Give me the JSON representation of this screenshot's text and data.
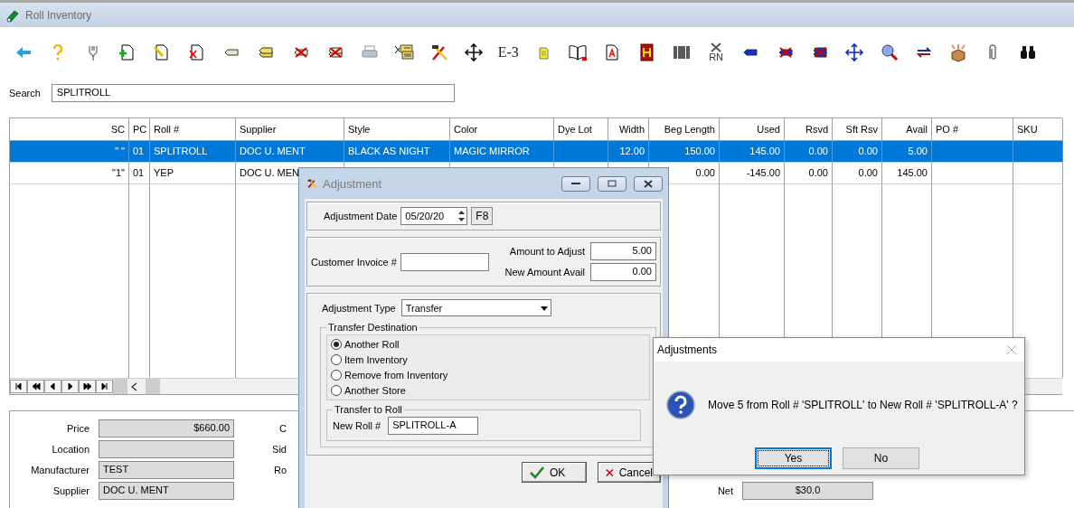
{
  "window": {
    "title": "Roll Inventory"
  },
  "toolbar": [
    {
      "kind": "icon"
    },
    {
      "kind": "icon"
    },
    {
      "kind": "icon"
    },
    {
      "kind": "icon"
    },
    {
      "kind": "icon"
    },
    {
      "kind": "icon"
    },
    {
      "kind": "icon"
    },
    {
      "kind": "icon"
    },
    {
      "kind": "icon"
    },
    {
      "kind": "icon"
    },
    {
      "kind": "icon"
    },
    {
      "kind": "icon"
    },
    {
      "kind": "icon"
    },
    {
      "kind": "icon"
    },
    {
      "kind": "text",
      "label": "E-3"
    },
    {
      "kind": "icon"
    },
    {
      "kind": "icon"
    },
    {
      "kind": "icon"
    },
    {
      "kind": "icon"
    },
    {
      "kind": "icon"
    },
    {
      "kind": "caption",
      "label": "RN"
    },
    {
      "kind": "icon"
    },
    {
      "kind": "icon"
    },
    {
      "kind": "icon"
    },
    {
      "kind": "icon"
    },
    {
      "kind": "icon"
    },
    {
      "kind": "icon"
    },
    {
      "kind": "icon"
    },
    {
      "kind": "icon"
    },
    {
      "kind": "icon"
    }
  ],
  "search": {
    "label": "Search",
    "value": "SPLITROLL"
  },
  "table": {
    "columns": [
      "SC",
      "PC",
      "Roll #",
      "Supplier",
      "Style",
      "Color",
      "Dye Lot",
      "Width",
      "Beg Length",
      "Used",
      "Rsvd",
      "Sft Rsv",
      "Avail",
      "PO #",
      "SKU"
    ],
    "rows": [
      {
        "selected": true,
        "cells": [
          "\" \"",
          "01",
          "SPLITROLL",
          "DOC U. MENT",
          "BLACK AS NIGHT",
          "MAGIC MIRROR",
          null,
          "12.00",
          "150.00",
          "145.00",
          "0.00",
          "0.00",
          "5.00",
          null,
          null
        ]
      },
      {
        "selected": false,
        "cells": [
          "\"1\"",
          "01",
          "YEP",
          "DOC U. MEN",
          null,
          null,
          null,
          null,
          "0.00",
          "-145.00",
          "0.00",
          "0.00",
          "145.00",
          null,
          null
        ]
      }
    ]
  },
  "details": {
    "fields": [
      {
        "label": "Price",
        "value": "$660.00"
      },
      {
        "label": "Location"
      },
      {
        "label": "Manufacturer",
        "value": "TEST"
      },
      {
        "label": "Supplier",
        "value": "DOC U. MENT"
      }
    ],
    "column_2_labels": [
      "C",
      "Sid",
      "Ro"
    ],
    "net": {
      "label": "Net",
      "value": "$30.0"
    }
  },
  "adjustment_dialog": {
    "title": "Adjustment",
    "date_label": "Adjustment Date",
    "date": "05/20/20",
    "date_button": "F8",
    "invoice_label": "Customer Invoice #",
    "amount_label": "Amount to Adjust",
    "amount": "5.00",
    "new_avail_label": "New Amount Avail",
    "new_avail": "0.00",
    "type_label": "Adjustment Type",
    "type": "Transfer",
    "destination": {
      "title": "Transfer Destination",
      "options": [
        {
          "label": "Another Roll",
          "selected": true
        },
        {
          "label": "Item Inventory",
          "selected": false
        },
        {
          "label": "Remove from Inventory",
          "selected": false
        },
        {
          "label": "Another Store",
          "selected": false
        }
      ]
    },
    "transfer_to": {
      "title": "Transfer to Roll",
      "label": "New Roll #",
      "value": "SPLITROLL-A"
    },
    "buttons": [
      {
        "kind": "ok",
        "label": "OK"
      },
      {
        "kind": "cancel",
        "label": "Cancel"
      }
    ]
  },
  "message_box": {
    "title": "Adjustments",
    "message": "Move 5 from Roll # 'SPLITROLL' to New Roll # 'SPLITROLL-A' ?",
    "buttons": [
      {
        "label": "Yes",
        "focused": true
      },
      {
        "label": "No",
        "focused": false
      }
    ]
  }
}
